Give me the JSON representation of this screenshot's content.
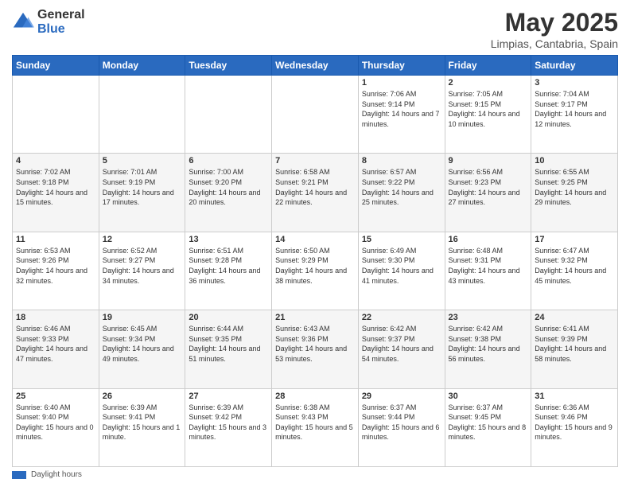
{
  "logo": {
    "general": "General",
    "blue": "Blue"
  },
  "header": {
    "month": "May 2025",
    "location": "Limpias, Cantabria, Spain"
  },
  "weekdays": [
    "Sunday",
    "Monday",
    "Tuesday",
    "Wednesday",
    "Thursday",
    "Friday",
    "Saturday"
  ],
  "weeks": [
    [
      {
        "day": "",
        "info": ""
      },
      {
        "day": "",
        "info": ""
      },
      {
        "day": "",
        "info": ""
      },
      {
        "day": "",
        "info": ""
      },
      {
        "day": "1",
        "info": "Sunrise: 7:06 AM\nSunset: 9:14 PM\nDaylight: 14 hours and 7 minutes."
      },
      {
        "day": "2",
        "info": "Sunrise: 7:05 AM\nSunset: 9:15 PM\nDaylight: 14 hours and 10 minutes."
      },
      {
        "day": "3",
        "info": "Sunrise: 7:04 AM\nSunset: 9:17 PM\nDaylight: 14 hours and 12 minutes."
      }
    ],
    [
      {
        "day": "4",
        "info": "Sunrise: 7:02 AM\nSunset: 9:18 PM\nDaylight: 14 hours and 15 minutes."
      },
      {
        "day": "5",
        "info": "Sunrise: 7:01 AM\nSunset: 9:19 PM\nDaylight: 14 hours and 17 minutes."
      },
      {
        "day": "6",
        "info": "Sunrise: 7:00 AM\nSunset: 9:20 PM\nDaylight: 14 hours and 20 minutes."
      },
      {
        "day": "7",
        "info": "Sunrise: 6:58 AM\nSunset: 9:21 PM\nDaylight: 14 hours and 22 minutes."
      },
      {
        "day": "8",
        "info": "Sunrise: 6:57 AM\nSunset: 9:22 PM\nDaylight: 14 hours and 25 minutes."
      },
      {
        "day": "9",
        "info": "Sunrise: 6:56 AM\nSunset: 9:23 PM\nDaylight: 14 hours and 27 minutes."
      },
      {
        "day": "10",
        "info": "Sunrise: 6:55 AM\nSunset: 9:25 PM\nDaylight: 14 hours and 29 minutes."
      }
    ],
    [
      {
        "day": "11",
        "info": "Sunrise: 6:53 AM\nSunset: 9:26 PM\nDaylight: 14 hours and 32 minutes."
      },
      {
        "day": "12",
        "info": "Sunrise: 6:52 AM\nSunset: 9:27 PM\nDaylight: 14 hours and 34 minutes."
      },
      {
        "day": "13",
        "info": "Sunrise: 6:51 AM\nSunset: 9:28 PM\nDaylight: 14 hours and 36 minutes."
      },
      {
        "day": "14",
        "info": "Sunrise: 6:50 AM\nSunset: 9:29 PM\nDaylight: 14 hours and 38 minutes."
      },
      {
        "day": "15",
        "info": "Sunrise: 6:49 AM\nSunset: 9:30 PM\nDaylight: 14 hours and 41 minutes."
      },
      {
        "day": "16",
        "info": "Sunrise: 6:48 AM\nSunset: 9:31 PM\nDaylight: 14 hours and 43 minutes."
      },
      {
        "day": "17",
        "info": "Sunrise: 6:47 AM\nSunset: 9:32 PM\nDaylight: 14 hours and 45 minutes."
      }
    ],
    [
      {
        "day": "18",
        "info": "Sunrise: 6:46 AM\nSunset: 9:33 PM\nDaylight: 14 hours and 47 minutes."
      },
      {
        "day": "19",
        "info": "Sunrise: 6:45 AM\nSunset: 9:34 PM\nDaylight: 14 hours and 49 minutes."
      },
      {
        "day": "20",
        "info": "Sunrise: 6:44 AM\nSunset: 9:35 PM\nDaylight: 14 hours and 51 minutes."
      },
      {
        "day": "21",
        "info": "Sunrise: 6:43 AM\nSunset: 9:36 PM\nDaylight: 14 hours and 53 minutes."
      },
      {
        "day": "22",
        "info": "Sunrise: 6:42 AM\nSunset: 9:37 PM\nDaylight: 14 hours and 54 minutes."
      },
      {
        "day": "23",
        "info": "Sunrise: 6:42 AM\nSunset: 9:38 PM\nDaylight: 14 hours and 56 minutes."
      },
      {
        "day": "24",
        "info": "Sunrise: 6:41 AM\nSunset: 9:39 PM\nDaylight: 14 hours and 58 minutes."
      }
    ],
    [
      {
        "day": "25",
        "info": "Sunrise: 6:40 AM\nSunset: 9:40 PM\nDaylight: 15 hours and 0 minutes."
      },
      {
        "day": "26",
        "info": "Sunrise: 6:39 AM\nSunset: 9:41 PM\nDaylight: 15 hours and 1 minute."
      },
      {
        "day": "27",
        "info": "Sunrise: 6:39 AM\nSunset: 9:42 PM\nDaylight: 15 hours and 3 minutes."
      },
      {
        "day": "28",
        "info": "Sunrise: 6:38 AM\nSunset: 9:43 PM\nDaylight: 15 hours and 5 minutes."
      },
      {
        "day": "29",
        "info": "Sunrise: 6:37 AM\nSunset: 9:44 PM\nDaylight: 15 hours and 6 minutes."
      },
      {
        "day": "30",
        "info": "Sunrise: 6:37 AM\nSunset: 9:45 PM\nDaylight: 15 hours and 8 minutes."
      },
      {
        "day": "31",
        "info": "Sunrise: 6:36 AM\nSunset: 9:46 PM\nDaylight: 15 hours and 9 minutes."
      }
    ]
  ],
  "legend": {
    "label": "Daylight hours"
  },
  "accent_color": "#2a6abf"
}
